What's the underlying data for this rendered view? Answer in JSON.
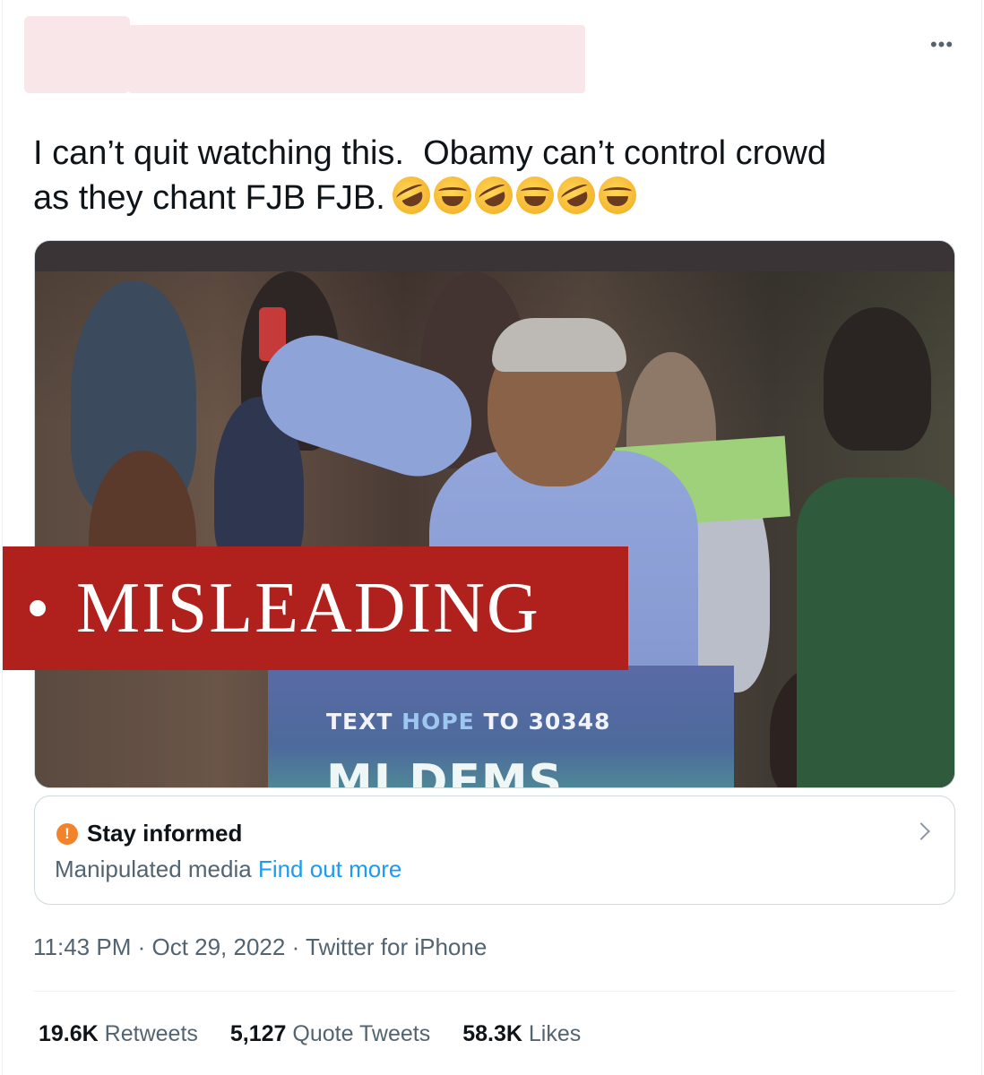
{
  "tweet": {
    "more_label": "•••",
    "text_line1": "I can’t quit watching this.  Obamy can’t control crowd",
    "text_line2": "as they chant FJB FJB.",
    "emojis": [
      "rolling-on-floor-laughing",
      "face-with-tears-of-joy",
      "rolling-on-floor-laughing",
      "face-with-tears-of-joy",
      "rolling-on-floor-laughing",
      "face-with-tears-of-joy"
    ]
  },
  "media": {
    "sign_line1_a": "TEXT ",
    "sign_line1_b": "HOPE",
    "sign_line1_c": " TO 30348",
    "sign_line2": "MI DEMS",
    "overlay_label": "MISLEADING",
    "overlay_color": "#b0201c"
  },
  "notice": {
    "icon": "!",
    "title": "Stay informed",
    "subtitle": "Manipulated media",
    "link": "Find out more"
  },
  "meta": {
    "time": "11:43 PM",
    "separator": " · ",
    "date": "Oct 29, 2022",
    "source": "Twitter for iPhone"
  },
  "stats": {
    "retweets_count": "19.6K",
    "retweets_label": "Retweets",
    "quotes_count": "5,127",
    "quotes_label": "Quote Tweets",
    "likes_count": "58.3K",
    "likes_label": "Likes"
  },
  "colors": {
    "link": "#1d9bf0",
    "secondary_text": "#536471",
    "warning_icon": "#f2832a"
  }
}
